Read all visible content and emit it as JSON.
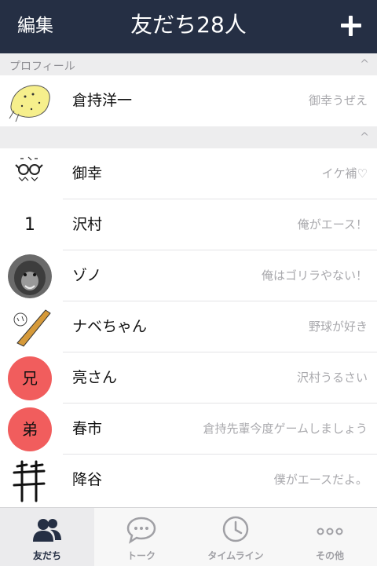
{
  "header": {
    "edit_label": "編集",
    "title": "友だち28人"
  },
  "profile_section": {
    "label": "プロフィール",
    "chevron": "^",
    "me": {
      "name": "倉持洋一",
      "status": "御幸うぜえ"
    }
  },
  "friends_section": {
    "chevron": "^",
    "friends": [
      {
        "name": "御幸",
        "status": "イケ補♡"
      },
      {
        "name": "沢村",
        "status": "俺がエース！",
        "avatar_text": "1"
      },
      {
        "name": "ゾノ",
        "status": "俺はゴリラやない！"
      },
      {
        "name": "ナベちゃん",
        "status": "野球が好き"
      },
      {
        "name": "亮さん",
        "status": "沢村うるさい",
        "avatar_text": "兄"
      },
      {
        "name": "春市",
        "status": "倉持先輩今度ゲームしましょう",
        "avatar_text": "弟"
      },
      {
        "name": "降谷",
        "status": "僕がエースだよ。"
      }
    ]
  },
  "tabs": [
    {
      "label": "友だち",
      "icon": "friends-icon",
      "active": true
    },
    {
      "label": "トーク",
      "icon": "chat-bubble-icon",
      "active": false
    },
    {
      "label": "タイムライン",
      "icon": "clock-icon",
      "active": false
    },
    {
      "label": "その他",
      "icon": "more-dots-icon",
      "active": false
    }
  ],
  "colors": {
    "header_bg": "#252f44",
    "avatar_red": "#f15d5d",
    "section_bg": "#ededee"
  }
}
